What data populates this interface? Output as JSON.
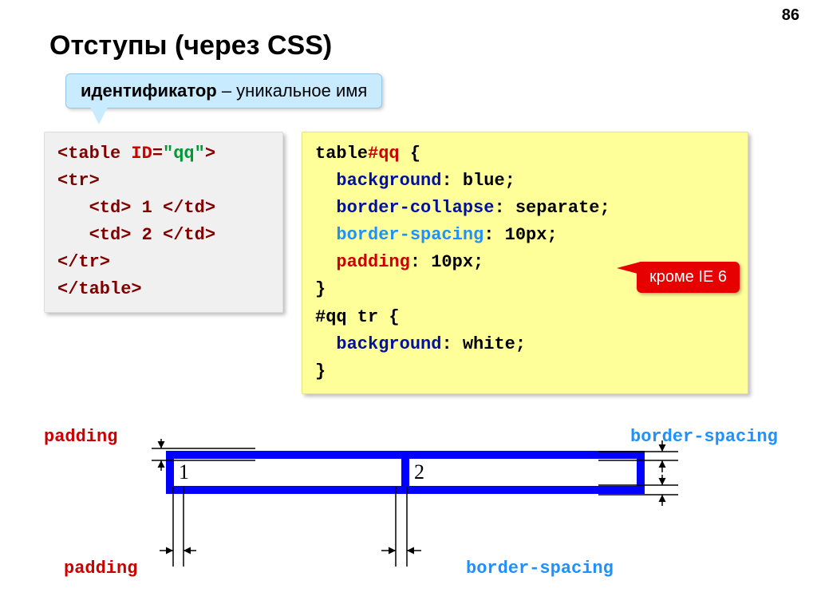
{
  "slideNumber": "86",
  "title": "Отступы (через CSS)",
  "callout": {
    "strong": "идентификатор",
    "rest": " – уникальное имя"
  },
  "html": {
    "l1a": "<table ",
    "l1b": "ID",
    "l1c": "=",
    "l1d": "\"qq\"",
    "l1e": ">",
    "l2": "<tr>",
    "l3": "   <td> 1 </td>",
    "l4": "   <td> 2 </td>",
    "l5": "</tr>",
    "l6": "</table>"
  },
  "css": {
    "l1a": "table",
    "l1b": "#qq",
    "l1c": " {",
    "l2a": "  ",
    "l2b": "background",
    "l2c": ": blue;",
    "l3a": "  ",
    "l3b": "border-collapse",
    "l3c": ": separate;",
    "l4a": "  ",
    "l4b": "border-spacing",
    "l4c": ": 10px;",
    "l5a": "  ",
    "l5b": "padding",
    "l5c": ": 10px;",
    "l6": "}",
    "l7": "#qq tr {",
    "l8a": "  ",
    "l8b": "background",
    "l8c": ": white;",
    "l9": "}"
  },
  "redTag": "кроме IE 6",
  "labels": {
    "padding": "padding",
    "borderSpacing": "border-spacing"
  },
  "cell1": "1",
  "cell2": "2"
}
